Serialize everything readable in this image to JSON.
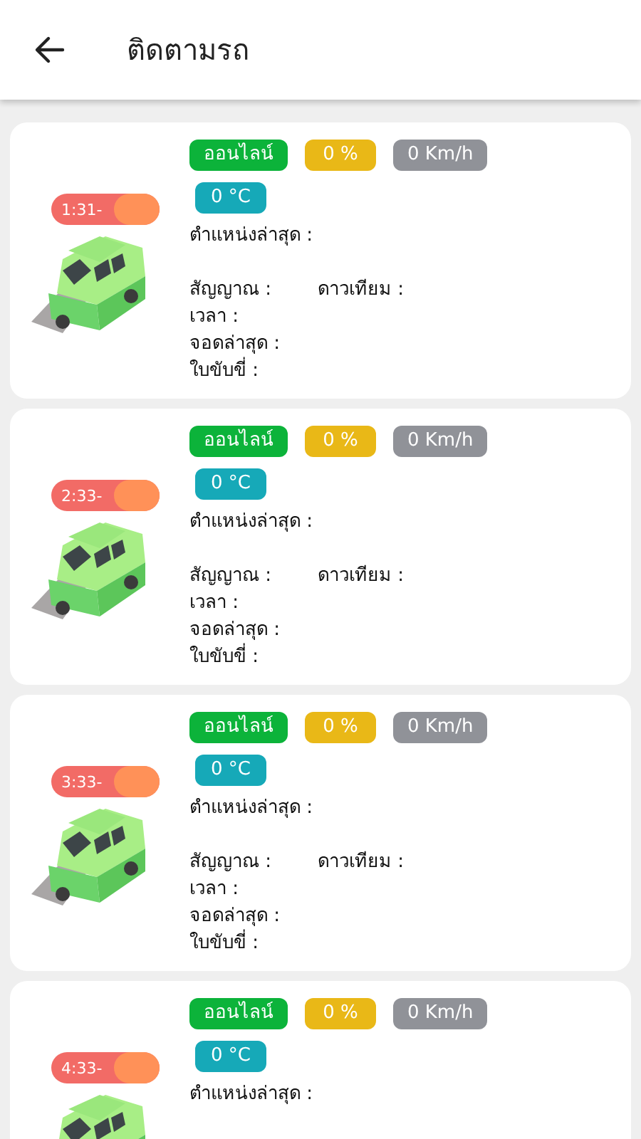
{
  "header": {
    "title": "ติดตามรถ"
  },
  "vehicles": [
    {
      "plate": "1:31-",
      "badges": [
        {
          "text": "ออนไลน์",
          "color": "#0cb33a"
        },
        {
          "text": "0 %",
          "color": "#e9b817"
        },
        {
          "text": "0 Km/h",
          "color": "#909298"
        },
        {
          "text": "0 °C",
          "color": "#16a9b8"
        }
      ],
      "position_label": "ตำแหน่งล่าสุด :",
      "signal_label": "สัญญาณ :",
      "satellite_label": "ดาวเทียม :",
      "lines": [
        "เวลา :",
        "จอดล่าสุด :",
        "ใบขับขี่ :"
      ]
    },
    {
      "plate": "2:33-",
      "badges": [
        {
          "text": "ออนไลน์",
          "color": "#0cb33a"
        },
        {
          "text": "0 %",
          "color": "#e9b817"
        },
        {
          "text": "0 Km/h",
          "color": "#909298"
        },
        {
          "text": "0 °C",
          "color": "#16a9b8"
        }
      ],
      "position_label": "ตำแหน่งล่าสุด :",
      "signal_label": "สัญญาณ :",
      "satellite_label": "ดาวเทียม :",
      "lines": [
        "เวลา :",
        "จอดล่าสุด :",
        "ใบขับขี่ :"
      ]
    },
    {
      "plate": "3:33-",
      "badges": [
        {
          "text": "ออนไลน์",
          "color": "#0cb33a"
        },
        {
          "text": "0 %",
          "color": "#e9b817"
        },
        {
          "text": "0 Km/h",
          "color": "#909298"
        },
        {
          "text": "0 °C",
          "color": "#16a9b8"
        }
      ],
      "position_label": "ตำแหน่งล่าสุด :",
      "signal_label": "สัญญาณ :",
      "satellite_label": "ดาวเทียม :",
      "lines": [
        "เวลา :",
        "จอดล่าสุด :",
        "ใบขับขี่ :"
      ]
    },
    {
      "plate": "4:33-",
      "badges": [
        {
          "text": "ออนไลน์",
          "color": "#0cb33a"
        },
        {
          "text": "0 %",
          "color": "#e9b817"
        },
        {
          "text": "0 Km/h",
          "color": "#909298"
        },
        {
          "text": "0 °C",
          "color": "#16a9b8"
        }
      ],
      "position_label": "ตำแหน่งล่าสุด :"
    }
  ]
}
